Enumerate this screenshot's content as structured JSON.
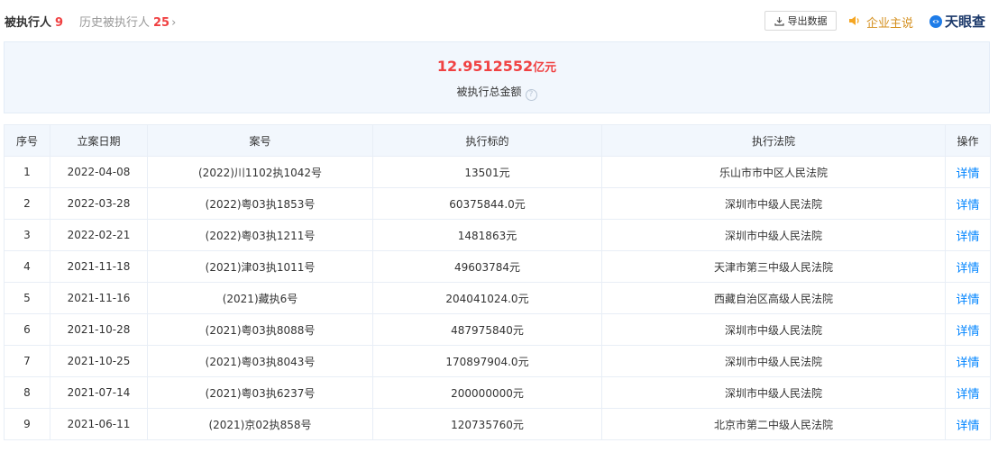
{
  "tabs": {
    "current_label": "被执行人",
    "current_count": "9",
    "history_label": "历史被执行人",
    "history_count": "25"
  },
  "toolbar": {
    "export_label": "导出数据",
    "biz_say_label": "企业主说",
    "logo_text": "天眼查"
  },
  "summary": {
    "amount": "12.9512552",
    "unit": "亿元",
    "label": "被执行总金额",
    "help": "?"
  },
  "colors": {
    "accent_red": "#f04142",
    "link_blue": "#0084ff",
    "header_bg": "#f2f7fd",
    "gold": "#d48f1e"
  },
  "table": {
    "headers": [
      "序号",
      "立案日期",
      "案号",
      "执行标的",
      "执行法院",
      "操作"
    ],
    "rows": [
      {
        "no": "1",
        "date": "2022-04-08",
        "case": "(2022)川1102执1042号",
        "amount": "13501元",
        "court": "乐山市市中区人民法院",
        "action": "详情"
      },
      {
        "no": "2",
        "date": "2022-03-28",
        "case": "(2022)粤03执1853号",
        "amount": "60375844.0元",
        "court": "深圳市中级人民法院",
        "action": "详情"
      },
      {
        "no": "3",
        "date": "2022-02-21",
        "case": "(2022)粤03执1211号",
        "amount": "1481863元",
        "court": "深圳市中级人民法院",
        "action": "详情"
      },
      {
        "no": "4",
        "date": "2021-11-18",
        "case": "(2021)津03执1011号",
        "amount": "49603784元",
        "court": "天津市第三中级人民法院",
        "action": "详情"
      },
      {
        "no": "5",
        "date": "2021-11-16",
        "case": "(2021)藏执6号",
        "amount": "204041024.0元",
        "court": "西藏自治区高级人民法院",
        "action": "详情"
      },
      {
        "no": "6",
        "date": "2021-10-28",
        "case": "(2021)粤03执8088号",
        "amount": "487975840元",
        "court": "深圳市中级人民法院",
        "action": "详情"
      },
      {
        "no": "7",
        "date": "2021-10-25",
        "case": "(2021)粤03执8043号",
        "amount": "170897904.0元",
        "court": "深圳市中级人民法院",
        "action": "详情"
      },
      {
        "no": "8",
        "date": "2021-07-14",
        "case": "(2021)粤03执6237号",
        "amount": "200000000元",
        "court": "深圳市中级人民法院",
        "action": "详情"
      },
      {
        "no": "9",
        "date": "2021-06-11",
        "case": "(2021)京02执858号",
        "amount": "120735760元",
        "court": "北京市第二中级人民法院",
        "action": "详情"
      }
    ]
  }
}
